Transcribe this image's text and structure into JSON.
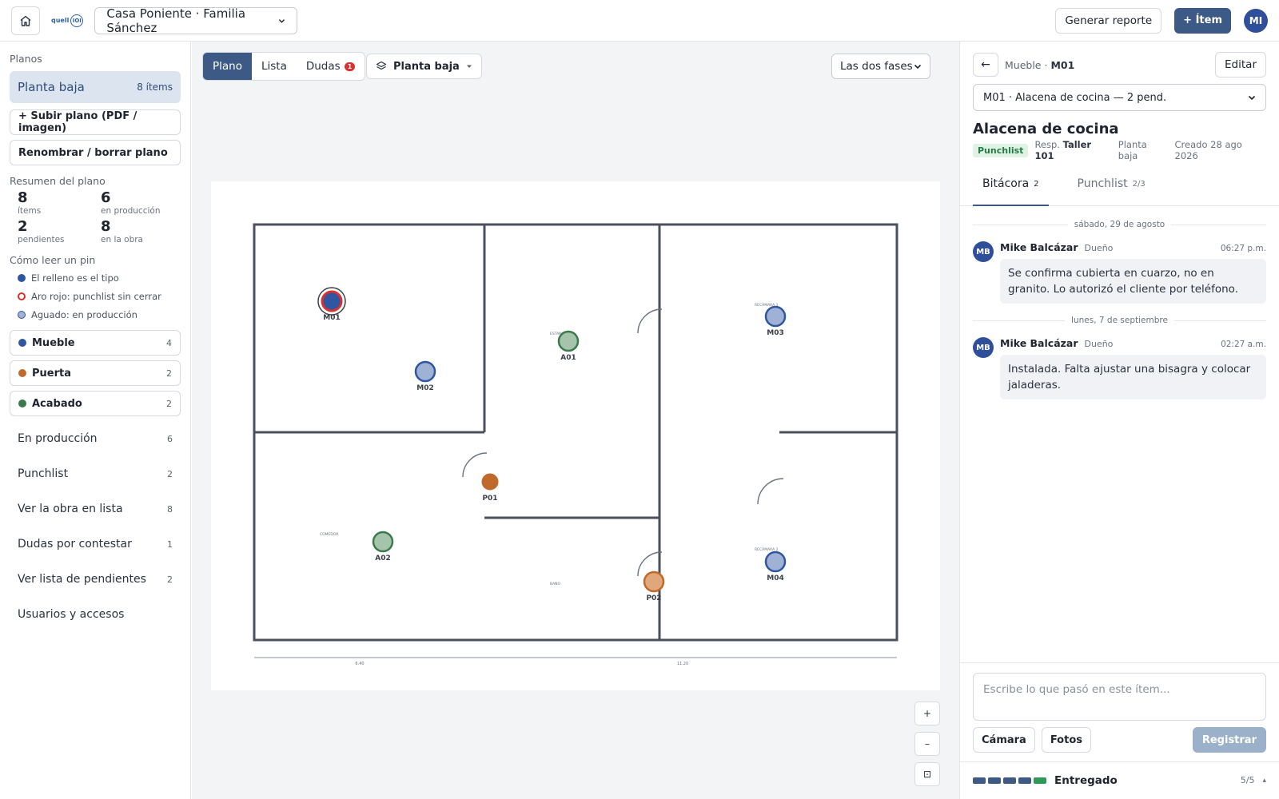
{
  "topbar": {
    "logo_text": "quell",
    "logo_ring": "IOI",
    "project": "Casa Poniente · Familia Sánchez",
    "report_label": "Generar reporte",
    "new_item_label": "+ Ítem",
    "user_initials": "MI"
  },
  "sidebar": {
    "plans_label": "Planos",
    "active_plan": {
      "name": "Planta baja",
      "count": "8 ítems"
    },
    "upload_label": "+ Subir plano (PDF / imagen)",
    "rename_label": "Renombrar / borrar plano",
    "summary_label": "Resumen del plano",
    "summary": [
      {
        "num": "8",
        "label": "ítems"
      },
      {
        "num": "6",
        "label": "en producción"
      },
      {
        "num": "2",
        "label": "pendientes"
      },
      {
        "num": "8",
        "label": "en la obra"
      }
    ],
    "legend_label": "Cómo leer un pin",
    "legend": [
      "El relleno es el tipo",
      "Aro rojo: punchlist sin cerrar",
      "Aguado: en producción"
    ],
    "types": [
      {
        "name": "Mueble",
        "count": "4",
        "color": "#2f56a0"
      },
      {
        "name": "Puerta",
        "count": "2",
        "color": "#c0692b"
      },
      {
        "name": "Acabado",
        "count": "2",
        "color": "#3c7a4c"
      }
    ],
    "nav": [
      {
        "label": "En producción",
        "count": "6"
      },
      {
        "label": "Punchlist",
        "count": "2"
      },
      {
        "label": "Ver la obra en lista",
        "count": "8"
      },
      {
        "label": "Dudas por contestar",
        "count": "1"
      },
      {
        "label": "Ver lista de pendientes",
        "count": "2"
      },
      {
        "label": "Usuarios y accesos",
        "count": ""
      }
    ]
  },
  "main": {
    "tabs": {
      "plano": "Plano",
      "lista": "Lista",
      "dudas": "Dudas",
      "dudas_badge": "1"
    },
    "floor": "Planta baja",
    "phase": "Las dos fases",
    "zoom_in": "+",
    "zoom_out": "–",
    "zoom_fit": "⊡",
    "room_labels": [
      "COMEDOR",
      "BAÑO",
      "ESTANCIA",
      "RECÁMARA 1",
      "RECÁMARA 2"
    ],
    "dims": [
      "6.40",
      "11.20"
    ],
    "pins": [
      {
        "label": "M01",
        "type": "Mueble",
        "state": "punchlist"
      },
      {
        "label": "M02",
        "type": "Mueble",
        "state": "produccion"
      },
      {
        "label": "A01",
        "type": "Acabado",
        "state": "produccion"
      },
      {
        "label": "M03",
        "type": "Mueble",
        "state": "produccion"
      },
      {
        "label": "P01",
        "type": "Puerta",
        "state": "obra"
      },
      {
        "label": "A02",
        "type": "Acabado",
        "state": "produccion"
      },
      {
        "label": "P02",
        "type": "Puerta",
        "state": "produccion"
      },
      {
        "label": "M04",
        "type": "Mueble",
        "state": "produccion"
      }
    ],
    "colors": {
      "mueble": "#2f56a0",
      "puerta": "#c0692b",
      "acabado": "#3c7a4c",
      "punchlist_ring": "#d9312f"
    }
  },
  "panel": {
    "back": "←",
    "crumb_type": "Mueble ·",
    "crumb_id": "M01",
    "edit_label": "Editar",
    "item_select": "M01 · Alacena de cocina — 2 pend.",
    "title": "Alacena de cocina",
    "status_pill": "Punchlist",
    "resp_label": "Resp.",
    "resp_value": "Taller 101",
    "floor": "Planta baja",
    "created": "Creado 28 ago 2026",
    "tabs": [
      {
        "label": "Bitácora",
        "n": "2"
      },
      {
        "label": "Punchlist",
        "n": "2/3"
      }
    ],
    "entries": [
      {
        "date": "sábado, 29 de agosto",
        "initials": "MB",
        "author": "Mike Balcázar",
        "role": "Dueño",
        "time": "06:27 p.m.",
        "text": "Se confirma cubierta en cuarzo, no en granito. Lo autorizó el cliente por teléfono."
      },
      {
        "date": "lunes, 7 de septiembre",
        "initials": "MB",
        "author": "Mike Balcázar",
        "role": "Dueño",
        "time": "02:27 a.m.",
        "text": "Instalada. Falta ajustar una bisagra y colocar jaladeras."
      }
    ],
    "composer_placeholder": "Escribe lo que pasó en este ítem...",
    "camera_label": "Cámara",
    "photos_label": "Fotos",
    "register_label": "Registrar",
    "status_label": "Entregado",
    "status_fraction": "5/5",
    "status_progress": 5,
    "status_chevron": "▴"
  }
}
